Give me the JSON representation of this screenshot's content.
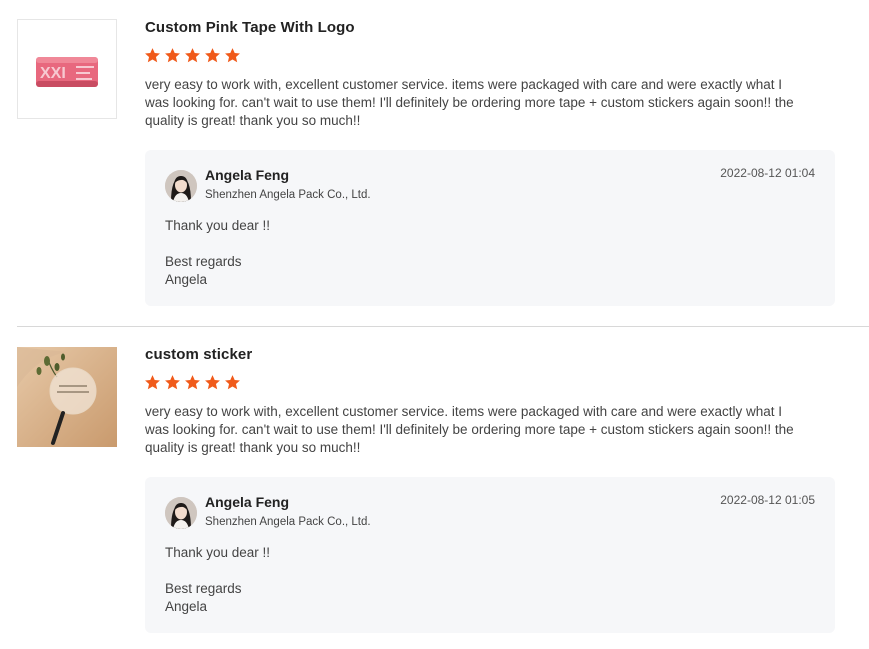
{
  "colors": {
    "star": "#f05a1a",
    "reply_bg": "#f6f7f9",
    "divider": "#d8d8d8"
  },
  "reviews": [
    {
      "product_title": "Custom Pink Tape With Logo",
      "rating": 5,
      "text": "very easy to work with, excellent customer service. items were packaged with care and were exactly what I was looking for. can't wait to use them! I'll definitely be ordering more tape + custom stickers again soon!! the quality is great! thank you so much!!",
      "thumbnail_icon": "pink-tape-roll-image",
      "reply": {
        "seller_name": "Angela Feng",
        "company": "Shenzhen Angela Pack Co., Ltd.",
        "date": "2022-08-12 01:04",
        "line1": "Thank you dear !!",
        "line2": "Best regards",
        "line3": "Angela"
      }
    },
    {
      "product_title": "custom sticker",
      "rating": 5,
      "text": "very easy to work with, excellent customer service. items were packaged with care and were exactly what I was looking for. can't wait to use them! I'll definitely be ordering more tape + custom stickers again soon!! the quality is great! thank you so much!!",
      "thumbnail_icon": "clear-sticker-photo",
      "reply": {
        "seller_name": "Angela Feng",
        "company": "Shenzhen Angela Pack Co., Ltd.",
        "date": "2022-08-12 01:05",
        "line1": "Thank you dear !!",
        "line2": "Best regards",
        "line3": "Angela"
      }
    }
  ]
}
